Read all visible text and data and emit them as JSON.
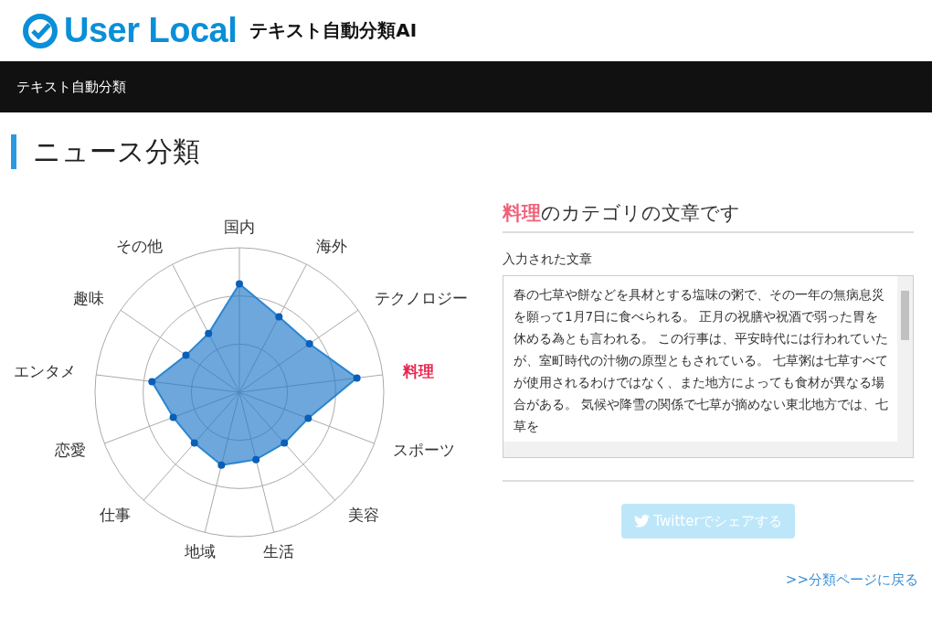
{
  "header": {
    "logo_text": "User Local",
    "product": "テキスト自動分類AI"
  },
  "nav": {
    "title": "テキスト自動分類"
  },
  "page_title": "ニュース分類",
  "radar": {
    "axes": [
      {
        "label": "国内",
        "selected": false
      },
      {
        "label": "海外",
        "selected": false
      },
      {
        "label": "テクノロジー",
        "selected": false
      },
      {
        "label": "料理",
        "selected": true
      },
      {
        "label": "スポーツ",
        "selected": false
      },
      {
        "label": "美容",
        "selected": false
      },
      {
        "label": "生活",
        "selected": false
      },
      {
        "label": "地域",
        "selected": false
      },
      {
        "label": "仕事",
        "selected": false
      },
      {
        "label": "恋愛",
        "selected": false
      },
      {
        "label": "エンタメ",
        "selected": false
      },
      {
        "label": "趣味",
        "selected": false
      },
      {
        "label": "その他",
        "selected": false
      }
    ]
  },
  "result": {
    "heading": "**料理**のカテゴリの文章です",
    "input_label": "入力された文章",
    "input_text": "春の七草や餅などを具材とする塩味の粥で、その一年の無病息災を願って1月7日に食べられる。 正月の祝膳や祝酒で弱った胃を休める為とも言われる。 この行事は、平安時代には行われていたが、室町時代の汁物の原型ともされている。 七草粥は七草すべてが使用されるわけではなく、また地方によっても食材が異なる場合がある。 気候や降雪の関係で七草が摘めない東北地方では、七草を",
    "share_button": {
      "label": "Twitterでシェアする",
      "disabled": true
    },
    "back_link": ">>分類ページに戻る"
  }
}
